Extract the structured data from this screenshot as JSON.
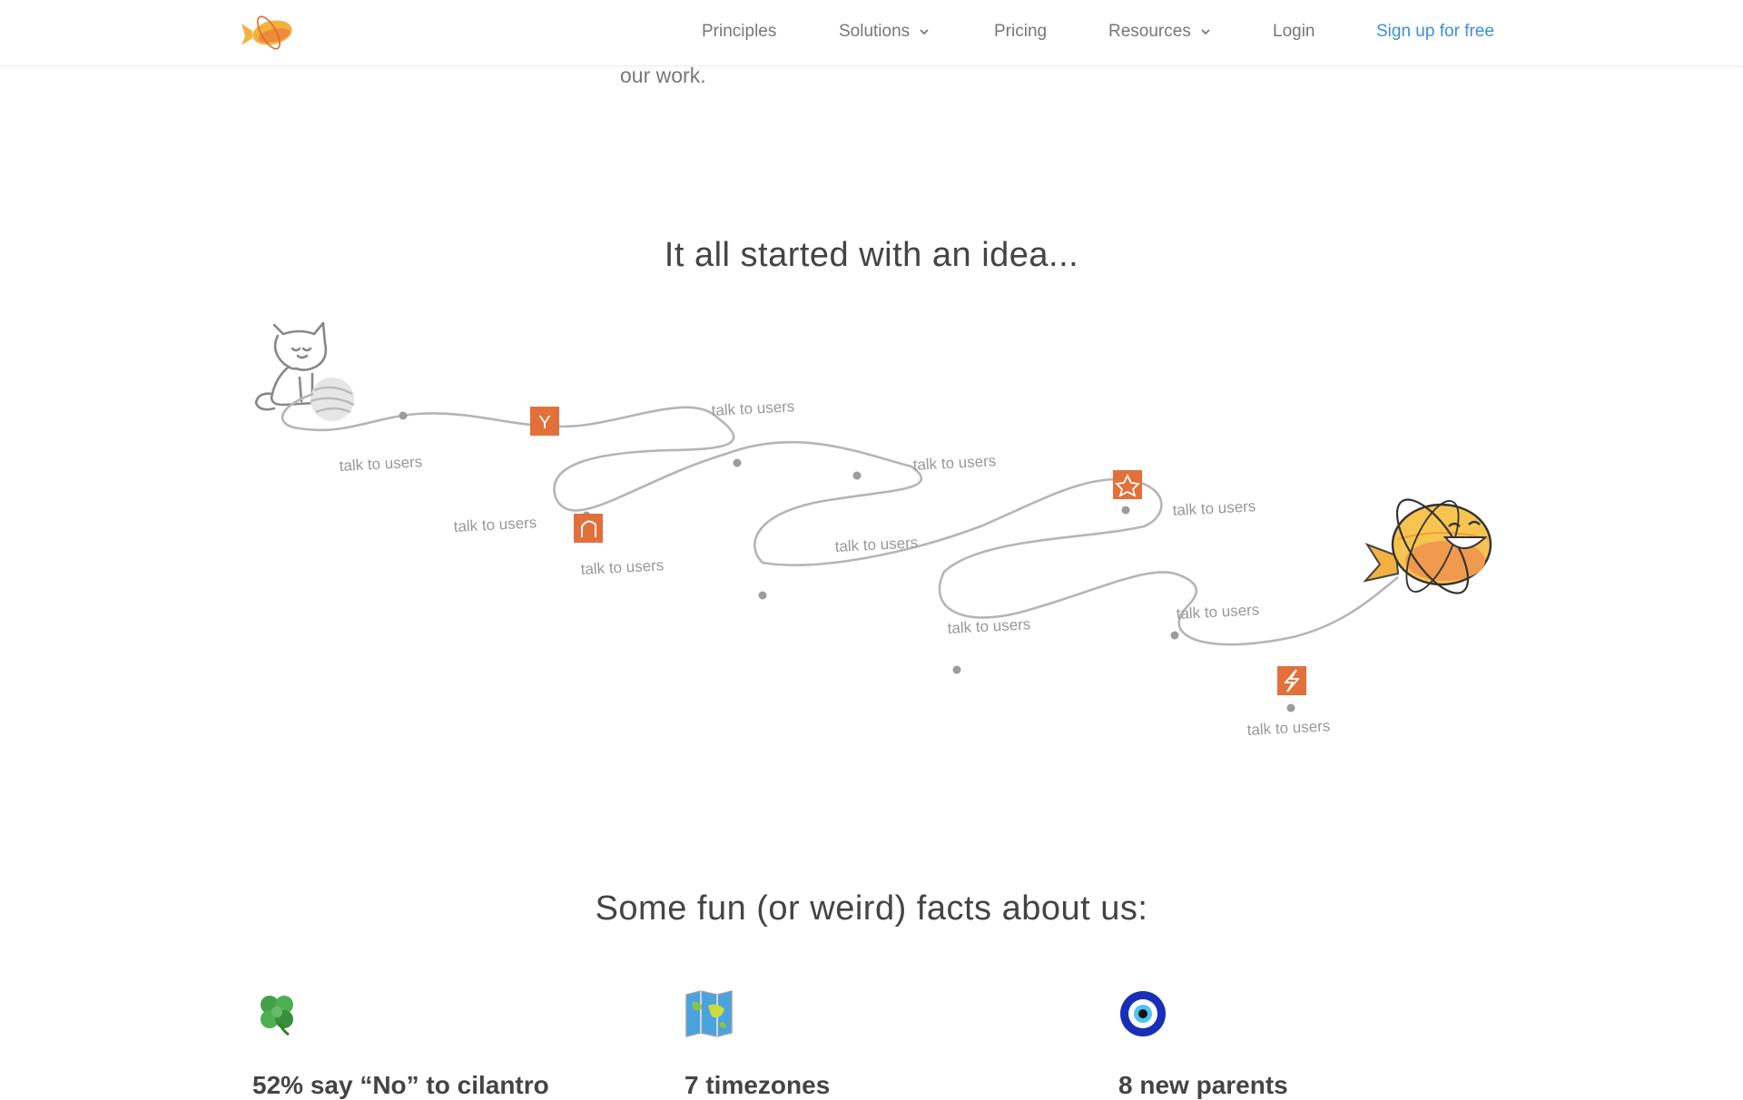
{
  "nav": {
    "principles": "Principles",
    "solutions": "Solutions",
    "pricing": "Pricing",
    "resources": "Resources",
    "login": "Login",
    "signup": "Sign up for free"
  },
  "intro": {
    "tail_text": "our work."
  },
  "journey": {
    "title": "It all started with an idea...",
    "labels": [
      "talk to users",
      "talk to users",
      "talk to users",
      "talk to users",
      "talk to users",
      "talk to users",
      "talk to users",
      "talk to users",
      "talk to users",
      "talk to users",
      "talk to users"
    ],
    "badges": [
      "Y",
      "",
      "",
      ""
    ]
  },
  "facts": {
    "title": "Some fun (or weird) facts about us:",
    "items": [
      {
        "icon": "four-leaf-clover-icon",
        "title": "52% say “No” to cilantro"
      },
      {
        "icon": "world-map-icon",
        "title": "7 timezones"
      },
      {
        "icon": "nazar-amulet-icon",
        "title": "8 new parents"
      }
    ]
  },
  "colors": {
    "accent": "#3d8ed8",
    "badge": "#e2703a",
    "path": "#b5b5b5",
    "brand": "#f2a93b"
  }
}
